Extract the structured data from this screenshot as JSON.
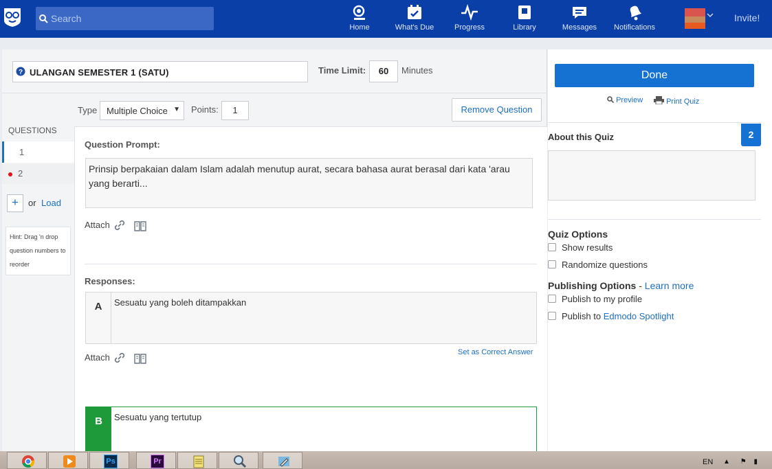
{
  "topnav": {
    "search_placeholder": "Search",
    "items": [
      {
        "label": "Home",
        "icon": "home-icon"
      },
      {
        "label": "What's Due",
        "icon": "calendar-check-icon"
      },
      {
        "label": "Progress",
        "icon": "pulse-icon"
      },
      {
        "label": "Library",
        "icon": "library-icon"
      },
      {
        "label": "Messages",
        "icon": "chat-icon"
      },
      {
        "label": "Notifications",
        "icon": "bell-icon"
      }
    ],
    "invite_label": "Invite!",
    "colors": {
      "bar": "#0a3fa8",
      "search_bg": "#3b68c4"
    }
  },
  "quiz": {
    "title": "ULANGAN SEMESTER 1 (SATU)",
    "time_limit_label": "Time Limit:",
    "time_limit_value": "60",
    "minutes_label": "Minutes"
  },
  "question_bar": {
    "type_label": "Type",
    "type_value": "Multiple Choice",
    "points_label": "Points:",
    "points_value": "1",
    "remove_label": "Remove Question"
  },
  "questions": {
    "heading": "QUESTIONS",
    "items": [
      "1",
      "2"
    ],
    "add_label": "+",
    "or_label": "or",
    "load_label": "Load",
    "hint": "Hint: Drag 'n drop question numbers to reorder"
  },
  "editor": {
    "prompt_label": "Question Prompt:",
    "prompt_text": "Prinsip berpakaian dalam Islam adalah menutup aurat, secara bahasa aurat berasal dari kata 'arau yang berarti...",
    "attach_label": "Attach",
    "responses_label": "Responses:",
    "answers": [
      {
        "letter": "A",
        "text": "Sesuatu yang boleh ditampakkan"
      },
      {
        "letter": "B",
        "text": "Sesuatu yang tertutup"
      }
    ],
    "set_correct_label": "Set as Correct Answer",
    "correct_color": "#1e9a3a"
  },
  "sidebar": {
    "done_label": "Done",
    "preview_label": "Preview",
    "print_label": "Print Quiz",
    "about_label": "About this Quiz",
    "question_count": "2",
    "quiz_options_label": "Quiz Options",
    "show_results_label": "Show results",
    "randomize_label": "Randomize questions",
    "publishing_label": "Publishing Options",
    "learn_more_label": "Learn more",
    "publish_profile_label": "Publish to my profile",
    "publish_to_label": "Publish to",
    "spotlight_label": "Edmodo Spotlight",
    "accent": "#1572d3"
  },
  "taskbar": {
    "apps": [
      "chrome-icon",
      "media-player-icon",
      "photoshop-icon",
      "premiere-icon",
      "notepad-icon",
      "search-tool-icon",
      "pencil-app-icon"
    ],
    "ps_label": "Ps",
    "pr_label": "Pr",
    "lang": "EN"
  }
}
